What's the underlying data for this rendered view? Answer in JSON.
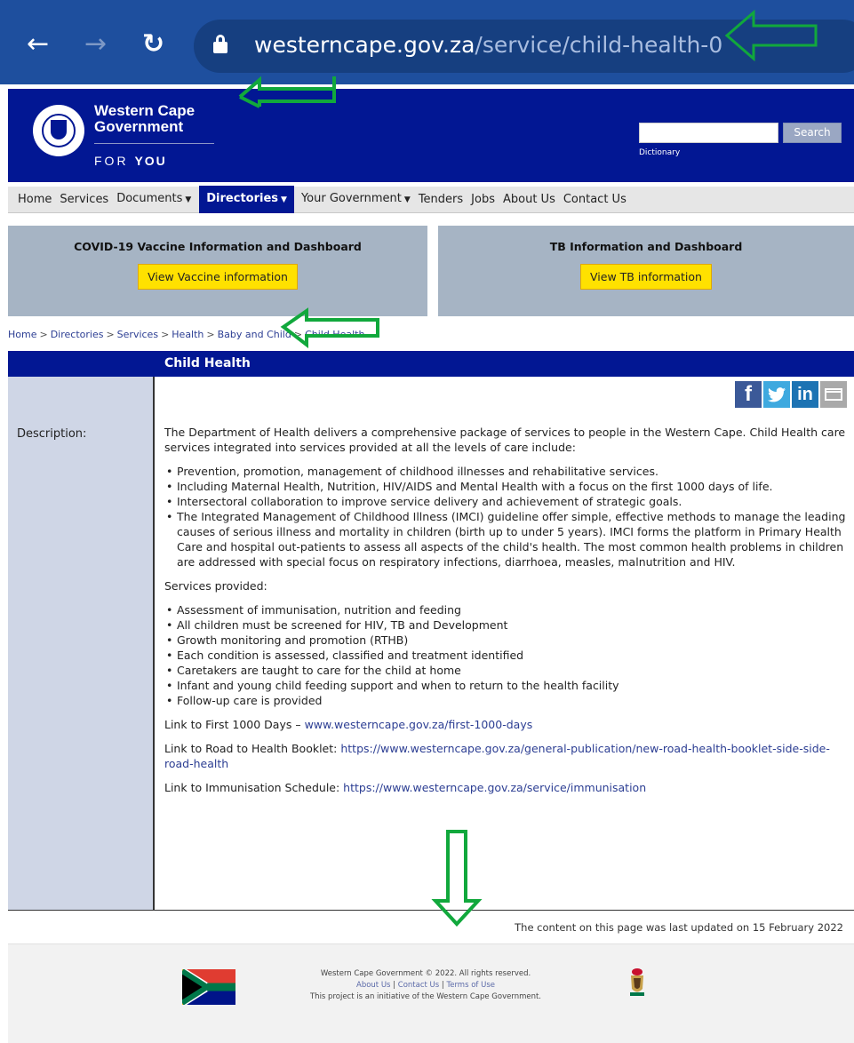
{
  "browser": {
    "url_host": "westerncape.gov.za",
    "url_path": "/service/child-health-0"
  },
  "header": {
    "brand_line1": "Western Cape",
    "brand_line2": "Government",
    "brand_for": "FOR",
    "brand_you": "YOU",
    "search_placeholder": "",
    "search_button": "Search",
    "dictionary_link": "Dictionary"
  },
  "menu": {
    "home": "Home",
    "services": "Services",
    "documents": "Documents",
    "directories": "Directories",
    "your_government": "Your Government",
    "tenders": "Tenders",
    "jobs": "Jobs",
    "about": "About Us",
    "contact": "Contact Us"
  },
  "promos": {
    "covid_title": "COVID-19 Vaccine Information and Dashboard",
    "covid_button": "View Vaccine information",
    "tb_title": "TB Information and Dashboard",
    "tb_button": "View TB information"
  },
  "breadcrumb": [
    "Home",
    "Directories",
    "Services",
    "Health",
    "Baby and Child",
    "Child Health"
  ],
  "page": {
    "title": "Child Health",
    "description_label": "Description:",
    "intro": "The Department of Health delivers a comprehensive package of services to people in the Western Cape. Child Health care services integrated into services provided at all the levels of care include:",
    "care_items": [
      "Prevention, promotion, management of childhood illnesses and rehabilitative services.",
      "Including Maternal Health, Nutrition, HIV/AIDS and Mental Health with a focus on the first 1000 days of life.",
      "Intersectoral collaboration to improve service delivery and achievement of strategic goals.",
      "The Integrated Management of Childhood Illness (IMCI) guideline offer simple, effective methods to manage the leading causes of serious illness and mortality in children (birth up to under 5 years). IMCI forms the platform in Primary Health Care and hospital out-patients to assess all aspects of the child's health. The most common health problems in children are addressed with special focus on respiratory infections, diarrhoea, measles, malnutrition and HIV."
    ],
    "services_heading": "Services provided:",
    "service_items": [
      "Assessment of immunisation, nutrition and feeding",
      "All children must be screened for HIV, TB and Development",
      "Growth monitoring and promotion (RTHB)",
      "Each condition is assessed, classified and treatment identified",
      "Caretakers are taught to care for the child at home",
      "Infant and young child feeding support and when to return to the health facility",
      "Follow-up care is provided"
    ],
    "link1_prefix": "Link to First 1000 Days – ",
    "link1_url": "www.westerncape.gov.za/first-1000-days",
    "link2_prefix": "Link to Road to Health Booklet: ",
    "link2_url": "https://www.westerncape.gov.za/general-publication/new-road-health-booklet-side-side-road-health",
    "link3_prefix": "Link to Immunisation Schedule: ",
    "link3_url": "https://www.westerncape.gov.za/service/immunisation",
    "last_updated": "The content on this page was last updated on 15 February 2022"
  },
  "share": {
    "facebook": "f",
    "twitter": "t",
    "linkedin": "in"
  },
  "footer": {
    "copyright": "Western Cape Government © 2022. All rights reserved.",
    "about": "About Us",
    "contact": "Contact Us",
    "terms": "Terms of Use",
    "initiative": "This project is an initiative of the Western Cape Government."
  },
  "colors": {
    "header_blue": "#021793",
    "browser_blue": "#1e4f9e",
    "promo_button": "#ffe100",
    "annotation_green": "#11a83c"
  }
}
